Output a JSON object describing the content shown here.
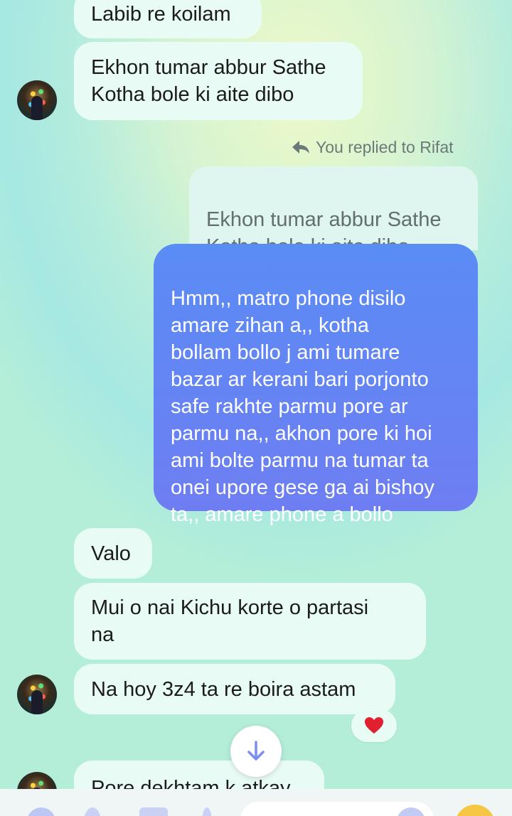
{
  "messages": {
    "m1": "Labib re koilam",
    "m2": "Ekhon tumar abbur Sathe\nKotha bole ki aite dibo",
    "reply_header": "You replied to Rifat",
    "reply_quote": "Ekhon tumar abbur Sathe\nKotha bole ki aite dibo",
    "sent": "Hmm,, matro phone disilo\namare zihan a,,  kotha\nbollam bollo j ami tumare\nbazar ar kerani bari porjonto\nsafe rakhte parmu pore ar\nparmu na,,  akhon pore ki hoi\nami bolte parmu na tumar ta\nonei upore gese ga ai bishoy\nta,,  amare phone a bollo",
    "m3": "Valo",
    "m4": "Mui o nai Kichu korte o partasi\nna",
    "m5": "Na hoy 3z4 ta re boira astam",
    "m6": "Pore dekhtam k atkay"
  },
  "reaction": {
    "icon": "heart-icon",
    "color": "#e0202e"
  },
  "scroll_button": {
    "icon": "arrow-down-icon",
    "color": "#7b8ef0"
  },
  "colors": {
    "sent_bubble": "#5a8cf5",
    "received_bubble": "#e8fbf4"
  }
}
